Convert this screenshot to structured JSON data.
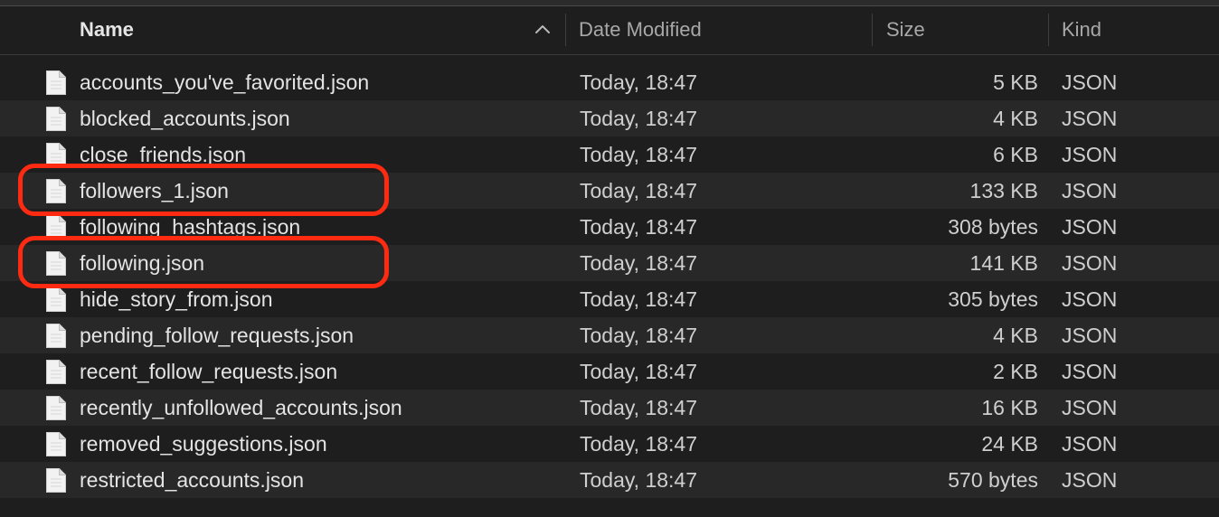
{
  "header": {
    "name_label": "Name",
    "date_label": "Date Modified",
    "size_label": "Size",
    "kind_label": "Kind",
    "sort_direction": "ascending",
    "sort_icon": "chevron-up-icon"
  },
  "files": [
    {
      "name": "accounts_you've_favorited.json",
      "date": "Today, 18:47",
      "size": "5 KB",
      "kind": "JSON"
    },
    {
      "name": "blocked_accounts.json",
      "date": "Today, 18:47",
      "size": "4 KB",
      "kind": "JSON"
    },
    {
      "name": "close_friends.json",
      "date": "Today, 18:47",
      "size": "6 KB",
      "kind": "JSON"
    },
    {
      "name": "followers_1.json",
      "date": "Today, 18:47",
      "size": "133 KB",
      "kind": "JSON"
    },
    {
      "name": "following_hashtags.json",
      "date": "Today, 18:47",
      "size": "308 bytes",
      "kind": "JSON"
    },
    {
      "name": "following.json",
      "date": "Today, 18:47",
      "size": "141 KB",
      "kind": "JSON"
    },
    {
      "name": "hide_story_from.json",
      "date": "Today, 18:47",
      "size": "305 bytes",
      "kind": "JSON"
    },
    {
      "name": "pending_follow_requests.json",
      "date": "Today, 18:47",
      "size": "4 KB",
      "kind": "JSON"
    },
    {
      "name": "recent_follow_requests.json",
      "date": "Today, 18:47",
      "size": "2 KB",
      "kind": "JSON"
    },
    {
      "name": "recently_unfollowed_accounts.json",
      "date": "Today, 18:47",
      "size": "16 KB",
      "kind": "JSON"
    },
    {
      "name": "removed_suggestions.json",
      "date": "Today, 18:47",
      "size": "24 KB",
      "kind": "JSON"
    },
    {
      "name": "restricted_accounts.json",
      "date": "Today, 18:47",
      "size": "570 bytes",
      "kind": "JSON"
    }
  ],
  "annotations": {
    "highlighted_files": [
      "followers_1.json",
      "following.json"
    ],
    "highlight_color": "#ff2a12"
  },
  "colors": {
    "background": "#1e1e1e",
    "alt_row": "#282828",
    "text": "#e4e4e4",
    "header_text": "#a8a8a8"
  },
  "file_icon": "document-icon"
}
